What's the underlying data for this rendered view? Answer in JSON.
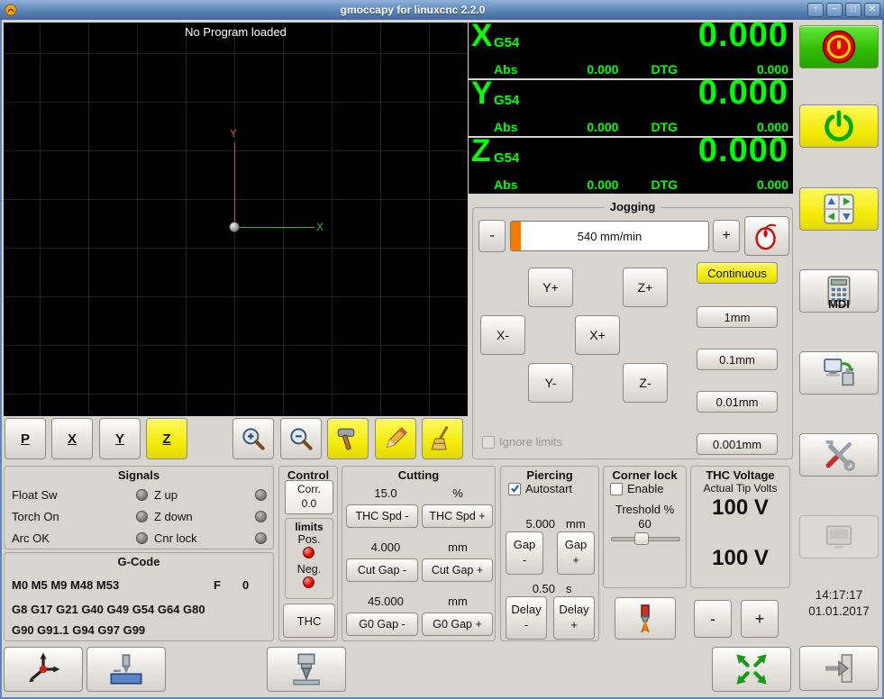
{
  "colors": {
    "titlebar_blue": "#5d84b6",
    "dro_green": "#00ff00",
    "dro_bg": "#000000",
    "highlight_yellow": "#f3ea07",
    "progress_orange": "#f57900",
    "led_red": "#e00000",
    "estop_green": "#2dbb00",
    "axis_x_green": "#35b035",
    "axis_y_red": "#c05050"
  },
  "window": {
    "title": "gmoccapy for linuxcnc  2.2.0",
    "shade_glyph": "↑",
    "minimize_glyph": "−",
    "maximize_glyph": "□",
    "close_glyph": "✕"
  },
  "preview": {
    "message": "No Program loaded",
    "x_axis_label": "X",
    "y_axis_label": "Y"
  },
  "preview_toolbar": {
    "front_view": "P",
    "x_view": "X",
    "y_view": "Y",
    "z_view": "Z"
  },
  "dro": {
    "axes": [
      {
        "letter": "X",
        "system": "G54",
        "value": "0.000",
        "abs_label": "Abs",
        "abs": "0.000",
        "dtg_label": "DTG",
        "dtg": "0.000"
      },
      {
        "letter": "Y",
        "system": "G54",
        "value": "0.000",
        "abs_label": "Abs",
        "abs": "0.000",
        "dtg_label": "DTG",
        "dtg": "0.000"
      },
      {
        "letter": "Z",
        "system": "G54",
        "value": "0.000",
        "abs_label": "Abs",
        "abs": "0.000",
        "dtg_label": "DTG",
        "dtg": "0.000"
      }
    ]
  },
  "jogging": {
    "title": "Jogging",
    "speed_minus": "-",
    "speed_plus": "+",
    "speed": "540 mm/min",
    "continuous": "Continuous",
    "y_plus": "Y+",
    "z_plus": "Z+",
    "x_minus": "X-",
    "x_plus": "X+",
    "y_minus": "Y-",
    "z_minus": "Z-",
    "increments": [
      "1mm",
      "0.1mm",
      "0.01mm",
      "0.001mm"
    ],
    "ignore_limits": "Ignore limits"
  },
  "right_bar": {
    "mdi_label": "MDI",
    "time": "14:17:17",
    "date": "01.01.2017"
  },
  "signals": {
    "title": "Signals",
    "rows": [
      {
        "left": "Float Sw",
        "right": "Z up"
      },
      {
        "left": "Torch On",
        "right": "Z down"
      },
      {
        "left": "Arc OK",
        "right": "Cnr lock"
      }
    ]
  },
  "gcode": {
    "title": "G-Code",
    "m_codes": "M0 M5 M9 M48 M53",
    "f_label": "F",
    "f_value": "0",
    "g_codes": "G8 G17 G21 G40 G49 G54 G64 G80\nG90 G91.1 G94 G97 G99"
  },
  "control": {
    "title": "Control",
    "corr": "Corr.\n0.0",
    "limits_title": "limits",
    "pos": "Pos.",
    "neg": "Neg.",
    "thc": "THC"
  },
  "cutting": {
    "title": "Cutting",
    "feed": "15.0",
    "feed_unit": "%",
    "thc_spd_minus": "THC Spd -",
    "thc_spd_plus": "THC Spd +",
    "cut_gap": "4.000",
    "cut_gap_unit": "mm",
    "cut_gap_minus": "Cut Gap -",
    "cut_gap_plus": "Cut Gap +",
    "g0_gap": "45.000",
    "g0_gap_unit": "mm",
    "g0_gap_minus": "G0 Gap -",
    "g0_gap_plus": "G0 Gap +"
  },
  "piercing": {
    "title": "Piercing",
    "autostart": "Autostart",
    "gap": "5.000",
    "gap_unit": "mm",
    "gap_minus": "Gap\n-",
    "gap_plus": "Gap\n+",
    "delay": "0.50",
    "delay_unit": "s",
    "delay_minus": "Delay\n-",
    "delay_plus": "Delay\n+"
  },
  "corner_lock": {
    "title": "Corner lock",
    "enable": "Enable",
    "threshold_label": "Treshold %",
    "threshold_value": "60"
  },
  "thc_voltage": {
    "title": "THC Voltage",
    "actual_label": "Actual Tip Volts",
    "value_top": "100 V",
    "value_bottom": "100 V",
    "minus": "-",
    "plus": "+"
  }
}
